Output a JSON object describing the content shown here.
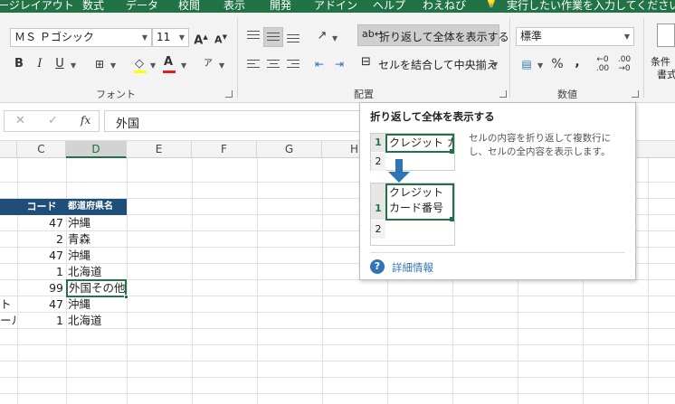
{
  "tabs": [
    "ージレイアウト",
    "数式",
    "データ",
    "校閲",
    "表示",
    "開発",
    "アドイン",
    "ヘルプ",
    "わえねび",
    "実行したい作業を入力してください"
  ],
  "tell_me_icon": "lightbulb-icon",
  "font": {
    "name": "ＭＳ Ｐゴシック",
    "size": "11",
    "group_label": "フォント",
    "bold": "B",
    "italic": "I",
    "underline": "U",
    "grow": "A",
    "shrink": "A",
    "color_letter": "A",
    "font_color": "#e02020"
  },
  "alignment": {
    "wrap_text": "折り返して全体を表示する",
    "merge_center": "セルを結合して中央揃え",
    "group_label": "配置"
  },
  "number": {
    "format": "標準",
    "percent": "%",
    "comma": ",",
    "group_label": "数値"
  },
  "styles": {
    "cond_format_line1": "条件",
    "cond_format_line2": "書式"
  },
  "formula_bar": {
    "cancel": "✕",
    "enter": "✓",
    "fx": "fx",
    "value": "外国"
  },
  "columns": [
    "C",
    "D",
    "E",
    "F",
    "G",
    "H"
  ],
  "selected_column": "D",
  "table": {
    "header": {
      "code": "コード",
      "pref": "都道府県名"
    },
    "rows": [
      {
        "a": "",
        "code": "47",
        "pref": "沖縄"
      },
      {
        "a": "",
        "code": "2",
        "pref": "青森"
      },
      {
        "a": "",
        "code": "47",
        "pref": "沖縄"
      },
      {
        "a": "",
        "code": "1",
        "pref": "北海道"
      },
      {
        "a": "",
        "code": "99",
        "pref": "外国その他"
      },
      {
        "a": "ト",
        "code": "47",
        "pref": "沖縄"
      },
      {
        "a": "ール",
        "code": "1",
        "pref": "北海道"
      }
    ]
  },
  "tooltip": {
    "title": "折り返して全体を表示する",
    "description_line1": "セルの内容を折り返して複数行に",
    "description_line2": "し、セルの全内容を表示します。",
    "before_text": "クレジット カ",
    "after_line1": "クレジット",
    "after_line2": "カード番号",
    "row1": "1",
    "row2": "2",
    "more_info": "詳細情報",
    "help_icon": "?"
  },
  "colors": {
    "excel_green": "#217346",
    "header_blue": "#1f4e79",
    "info_blue": "#2e75b6"
  }
}
